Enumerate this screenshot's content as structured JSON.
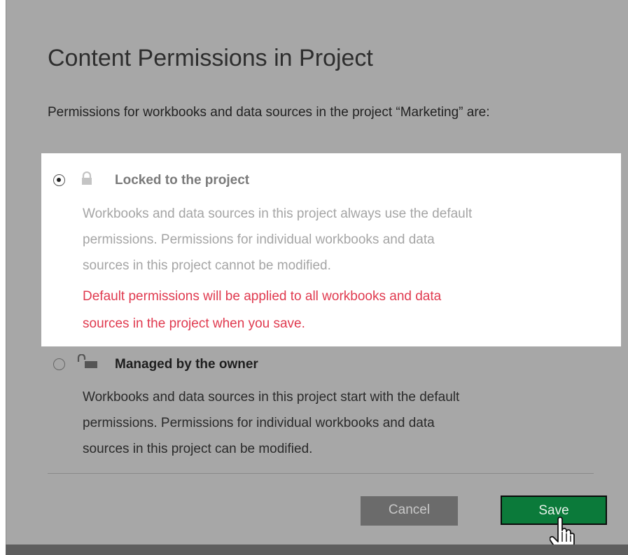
{
  "dialog": {
    "title": "Content Permissions in Project",
    "intro": "Permissions for workbooks and data sources in the project “Marketing” are:"
  },
  "options": [
    {
      "label": "Locked to the project",
      "selected": true,
      "icon": "lock-closed-icon",
      "description_lines": [
        "Workbooks and data sources in this project always use the default",
        "permissions. Permissions for individual workbooks and data",
        "sources in this project cannot be modified."
      ],
      "warning_lines": [
        "Default permissions will be applied to all workbooks and data",
        "sources in the project when you save."
      ]
    },
    {
      "label": "Managed by the owner",
      "selected": false,
      "icon": "lock-open-icon",
      "description_lines": [
        "Workbooks and data sources in this project start with the default",
        "permissions. Permissions for individual workbooks and data",
        "sources in this project can be modified."
      ]
    }
  ],
  "buttons": {
    "cancel": "Cancel",
    "save": "Save"
  },
  "colors": {
    "overlay": "#a7a7a7",
    "warning": "#e03a4f",
    "save_button": "#0b7a3a",
    "cancel_button": "#6b6b6b"
  }
}
